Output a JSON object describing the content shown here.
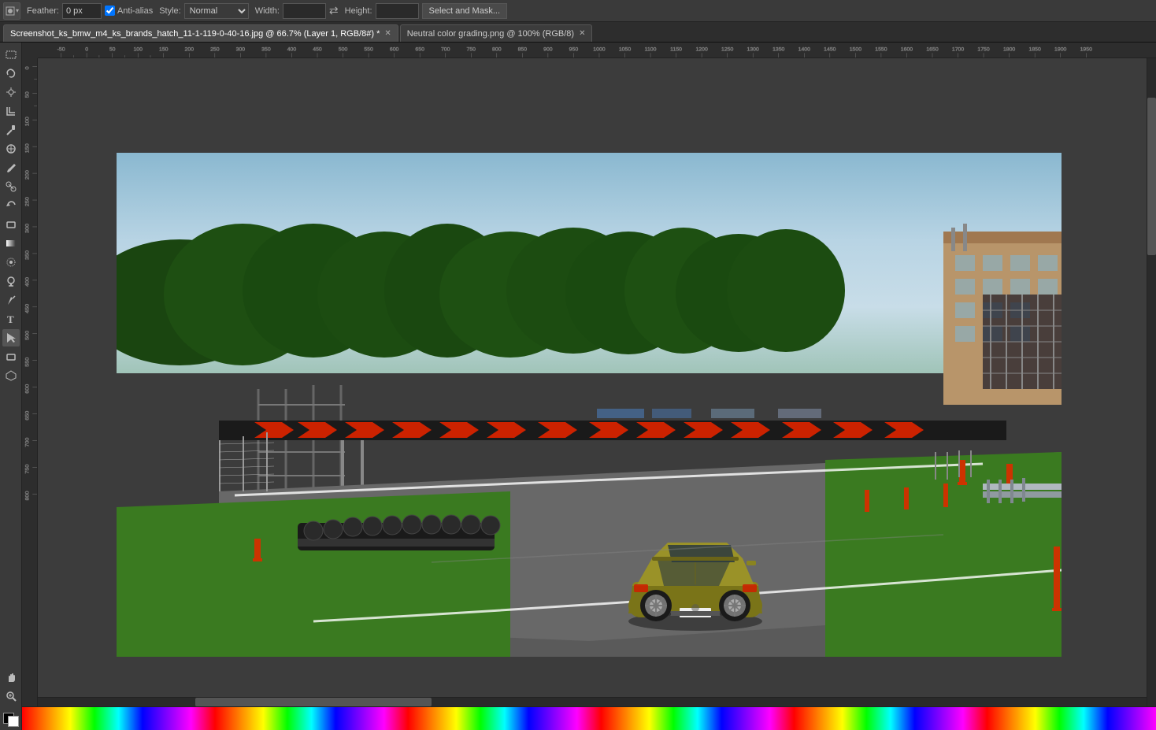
{
  "toolbar": {
    "tool_dropdown_label": "▾",
    "feather_label": "Feather:",
    "feather_value": "0 px",
    "antialiase_label": "Anti-alias",
    "style_label": "Style:",
    "style_value": "Normal",
    "width_label": "Width:",
    "height_label": "Height:",
    "select_mask_btn": "Select and Mask..."
  },
  "tabs": [
    {
      "id": "tab1",
      "label": "Screenshot_ks_bmw_m4_ks_brands_hatch_11-1-119-0-40-16.jpg @ 66.7% (Layer 1, RGB/8#) *",
      "active": true
    },
    {
      "id": "tab2",
      "label": "Neutral color grading.png @ 100% (RGB/8)",
      "active": false
    }
  ],
  "left_tools": [
    {
      "name": "marquee-tool",
      "icon": "▭",
      "active": false
    },
    {
      "name": "lasso-tool",
      "icon": "⌒",
      "active": false
    },
    {
      "name": "magic-wand-tool",
      "icon": "✦",
      "active": false
    },
    {
      "name": "crop-tool",
      "icon": "⊡",
      "active": false
    },
    {
      "name": "eyedropper-tool",
      "icon": "✏",
      "active": false
    },
    {
      "name": "healing-brush-tool",
      "icon": "⊕",
      "active": false
    },
    {
      "name": "brush-tool",
      "icon": "✎",
      "active": false
    },
    {
      "name": "clone-tool",
      "icon": "⎘",
      "active": false
    },
    {
      "name": "history-brush-tool",
      "icon": "↩",
      "active": false
    },
    {
      "name": "eraser-tool",
      "icon": "◻",
      "active": false
    },
    {
      "name": "gradient-tool",
      "icon": "▦",
      "active": false
    },
    {
      "name": "blur-tool",
      "icon": "◉",
      "active": false
    },
    {
      "name": "dodge-tool",
      "icon": "⊙",
      "active": false
    },
    {
      "name": "pen-tool",
      "icon": "✒",
      "active": false
    },
    {
      "name": "text-tool",
      "icon": "T",
      "active": false
    },
    {
      "name": "path-selection-tool",
      "icon": "▸",
      "active": true
    },
    {
      "name": "shape-tool",
      "icon": "▭",
      "active": false
    },
    {
      "name": "3d-tool",
      "icon": "⬡",
      "active": false
    },
    {
      "name": "hand-tool",
      "icon": "✋",
      "active": false
    },
    {
      "name": "zoom-tool",
      "icon": "⌕",
      "active": false
    }
  ],
  "ruler": {
    "top_marks": [
      "-50",
      "0",
      "50",
      "100",
      "150",
      "200",
      "250",
      "300",
      "350",
      "400",
      "450",
      "500",
      "550",
      "600",
      "650",
      "700",
      "750",
      "800",
      "850",
      "900",
      "950",
      "1000",
      "1050",
      "1100",
      "1150",
      "1200",
      "1250",
      "1300",
      "1350",
      "1400",
      "1450",
      "1500",
      "1550",
      "1600",
      "1650",
      "1700",
      "1750",
      "1800",
      "1850",
      "1900",
      "1950"
    ],
    "left_marks": [
      "0",
      "50",
      "100",
      "150",
      "200",
      "250",
      "300",
      "350",
      "400",
      "450",
      "500",
      "550",
      "600",
      "650",
      "700",
      "750",
      "800"
    ]
  },
  "canvas": {
    "zoom": "66.7%",
    "layer": "Layer 1",
    "mode": "RGB/8"
  },
  "colors": {
    "bg": "#3c3c3c",
    "toolbar_bg": "#3a3a3a",
    "tab_active_bg": "#4a4a4a",
    "ruler_bg": "#2d2d2d",
    "accent": "#1a6aad"
  }
}
